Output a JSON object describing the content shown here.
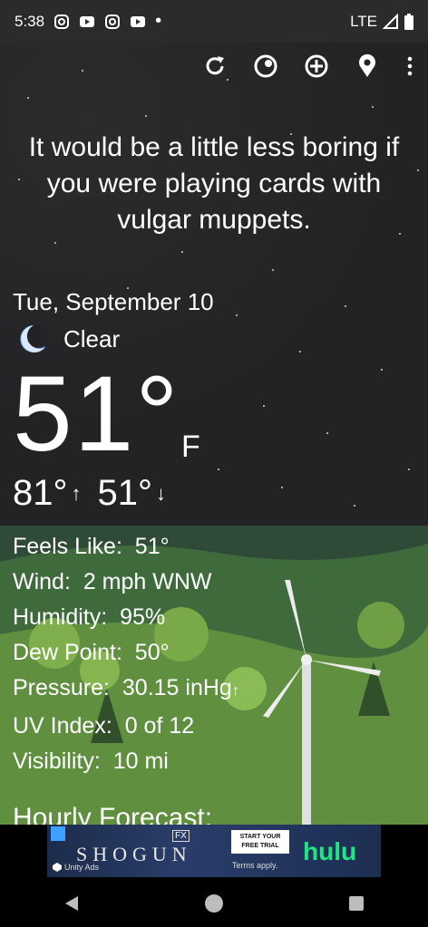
{
  "status_bar": {
    "time": "5:38",
    "network": "LTE",
    "notifications": [
      "instagram-icon",
      "youtube-icon",
      "instagram-icon",
      "youtube-icon",
      "dot"
    ]
  },
  "toolbar": {
    "icons": [
      "refresh-icon",
      "theme-icon",
      "add-location-icon",
      "location-pin-icon",
      "overflow-menu-icon"
    ]
  },
  "quote": "It would be a little less boring if you were playing cards with vulgar muppets.",
  "weather": {
    "date": "Tue, September 10",
    "condition": "Clear",
    "condition_icon": "moon-icon",
    "temperature": "51°",
    "unit": "F",
    "high": "81°",
    "low": "51°",
    "details": [
      {
        "label": "Feels Like:",
        "value": "51°"
      },
      {
        "label": "Wind:",
        "value": "2 mph WNW"
      },
      {
        "label": "Humidity:",
        "value": "95%"
      },
      {
        "label": "Dew Point:",
        "value": "50°"
      },
      {
        "label": "Pressure:",
        "value": "30.15 inHg"
      },
      {
        "label": "UV Index:",
        "value": "0 of 12"
      },
      {
        "label": "Visibility:",
        "value": "10 mi"
      }
    ],
    "hourly_heading": "Hourly Forecast:"
  },
  "ad": {
    "title": "SHOGUN",
    "badge": "FX",
    "cta": "START YOUR FREE TRIAL",
    "terms": "Terms apply.",
    "brand": "hulu",
    "network": "Unity Ads"
  },
  "colors": {
    "sky": "#232325",
    "grass": "#5f8f3f",
    "hulu": "#1ce783"
  }
}
